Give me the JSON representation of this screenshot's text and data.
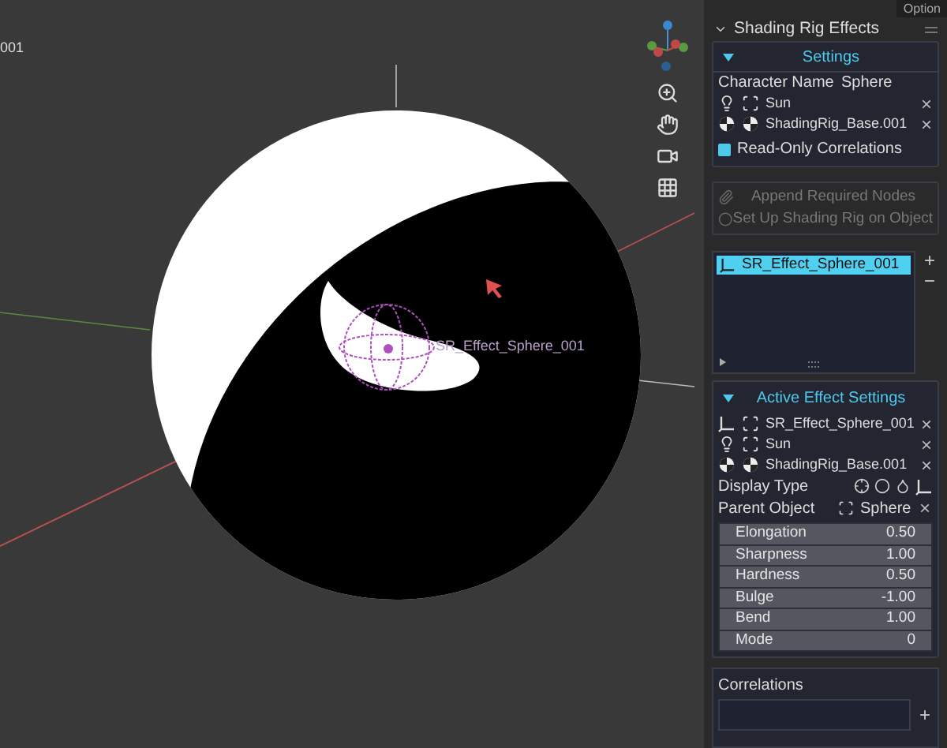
{
  "viewport": {
    "corner_label": "001",
    "object_label": "SR_Effect_Sphere_001"
  },
  "top_tab": "Option",
  "panel": {
    "title": "Shading Rig Effects",
    "expanded": true
  },
  "settings": {
    "title": "Settings",
    "expanded": true,
    "character_name": {
      "label": "Character Name",
      "value": "Sphere"
    },
    "objects": [
      {
        "kind": "light",
        "name": "Sun",
        "remove": "×"
      },
      {
        "kind": "shading",
        "name": "ShadingRig_Base.001",
        "remove": "×"
      }
    ],
    "read_only": {
      "label": "Read-Only Correlations",
      "checked": true
    }
  },
  "actions": [
    {
      "kind": "append",
      "label": "Append Required Nodes",
      "disabled": true
    },
    {
      "kind": "setup",
      "label": "Set Up Shading Rig on Object",
      "disabled": true
    }
  ],
  "effects_list": {
    "items": [
      {
        "name": "SR_Effect_Sphere_001",
        "selected": true
      }
    ],
    "add": "+",
    "remove": "−"
  },
  "active_effect": {
    "title": "Active Effect Settings",
    "expanded": true,
    "objects": [
      {
        "kind": "empty",
        "name": "SR_Effect_Sphere_001",
        "remove": "×"
      },
      {
        "kind": "light",
        "name": "Sun",
        "remove": "×"
      },
      {
        "kind": "shading",
        "name": "ShadingRig_Base.001",
        "remove": "×"
      }
    ],
    "display_type": {
      "label": "Display Type"
    },
    "parent": {
      "label": "Parent Object",
      "value": "Sphere",
      "remove": "×"
    },
    "fields": [
      {
        "label": "Elongation",
        "value": "0.50"
      },
      {
        "label": "Sharpness",
        "value": "1.00"
      },
      {
        "label": "Hardness",
        "value": "0.50"
      },
      {
        "label": "Bulge",
        "value": "-1.00"
      },
      {
        "label": "Bend",
        "value": "1.00"
      },
      {
        "label": "Mode",
        "value": "0"
      }
    ]
  },
  "correlations": {
    "title": "Correlations",
    "add": "+"
  }
}
